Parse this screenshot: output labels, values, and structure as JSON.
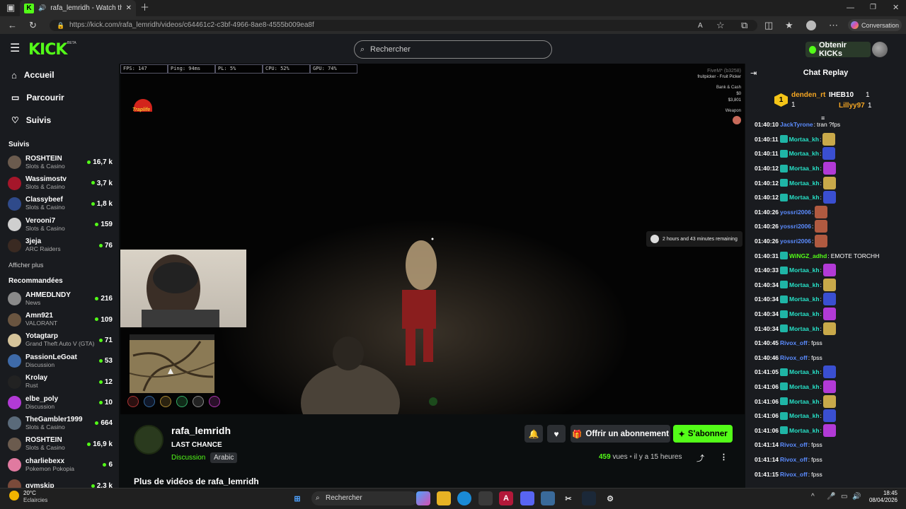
{
  "browser": {
    "tab_title": "rafa_lemridh - Watch the VO",
    "url": "https://kick.com/rafa_lemridh/videos/c64461c2-c3bf-4966-8ae8-4555b009ea8f",
    "conversation_label": "Conversation"
  },
  "header": {
    "logo": "KICK",
    "beta": "BETA",
    "search_placeholder": "Rechercher",
    "kicks_button": "Obtenir KICKs"
  },
  "sidebar": {
    "nav": [
      {
        "label": "Accueil",
        "icon": "home-icon"
      },
      {
        "label": "Parcourir",
        "icon": "browse-icon"
      },
      {
        "label": "Suivis",
        "icon": "heart-icon"
      }
    ],
    "followed_heading": "Suivis",
    "followed": [
      {
        "name": "ROSHTEIN",
        "category": "Slots & Casino",
        "viewers": "16,7 k",
        "color": "#6b5b4e"
      },
      {
        "name": "Wassimostv",
        "category": "Slots & Casino",
        "viewers": "3,7 k",
        "color": "#a5162a"
      },
      {
        "name": "Classybeef",
        "category": "Slots & Casino",
        "viewers": "1,8 k",
        "color": "#2f4a8a"
      },
      {
        "name": "Verooni7",
        "category": "Slots & Casino",
        "viewers": "159",
        "color": "#cfcfcf"
      },
      {
        "name": "3jeja",
        "category": "ARC Raiders",
        "viewers": "76",
        "color": "#3a2a22"
      }
    ],
    "show_more": "Afficher plus",
    "recommended_heading": "Recommandées",
    "recommended": [
      {
        "name": "AHMEDLNDY",
        "category": "News",
        "viewers": "216",
        "color": "#8a8a8a"
      },
      {
        "name": "Amn921",
        "category": "VALORANT",
        "viewers": "109",
        "color": "#6a5540"
      },
      {
        "name": "Yotagtarp",
        "category": "Grand Theft Auto V (GTA)",
        "viewers": "71",
        "color": "#d6c49a"
      },
      {
        "name": "PassionLeGoat",
        "category": "Discussion",
        "viewers": "53",
        "color": "#3e6aa8"
      },
      {
        "name": "Krolay",
        "category": "Rust",
        "viewers": "12",
        "color": "#222222"
      },
      {
        "name": "elbe_poly",
        "category": "Discussion",
        "viewers": "10",
        "color": "#b23ad6"
      },
      {
        "name": "TheGambler1999",
        "category": "Slots & Casino",
        "viewers": "664",
        "color": "#5a6a7a"
      },
      {
        "name": "ROSHTEIN",
        "category": "Slots & Casino",
        "viewers": "16,9 k",
        "color": "#6b5b4e"
      },
      {
        "name": "charliebexx",
        "category": "Pokemon Pokopia",
        "viewers": "6",
        "color": "#e07aa0"
      },
      {
        "name": "gymskip",
        "category": "",
        "viewers": "2,3 k",
        "color": "#7a4a3a"
      }
    ]
  },
  "video": {
    "hud": [
      "FPS: 147",
      "Ping: 94ms",
      "PL: 5%",
      "CPU: 52%",
      "GPU: 74%"
    ],
    "server_text": "FiveM* (b3258)",
    "job_text": "fruitpicker - Fruit Picker",
    "bank_label": "Bank & Cash",
    "bank_value": "$0",
    "cash_value": "$3,801",
    "weapon_label": "Weapon",
    "channel_logo": "Traplife",
    "remaining": "2 hours and 43 minutes remaining"
  },
  "stream": {
    "streamer": "rafa_lemridh",
    "title": "LAST CHANCE",
    "category": "Discussion",
    "tag": "Arabic",
    "gift_label": "Offrir un abonnement",
    "subscribe_label": "S'abonner",
    "views_count": "459",
    "views_label": "vues",
    "time_ago": "il y a 15 heures",
    "more_videos": "Plus de vidéos de rafa_lemridh"
  },
  "chat": {
    "title": "Chat Replay",
    "gifters": [
      {
        "rank": "1",
        "name": "denden_rt",
        "count": "1",
        "color": "#f5a623"
      },
      {
        "name": "IHEB10",
        "count": "1",
        "color": "#ffffff"
      },
      {
        "name": "Lillyy97",
        "count": "1",
        "color": "#f5a623"
      }
    ],
    "messages": [
      {
        "time": "01:40:10",
        "user": "JackTyrone",
        "color": "#5b8cff",
        "badge": false,
        "text": "tran ?fps",
        "emote": ""
      },
      {
        "time": "01:40:11",
        "user": "Mortaa_kh",
        "color": "#27e0c6",
        "badge": true,
        "text": "",
        "emote": "#c9a94a"
      },
      {
        "time": "01:40:11",
        "user": "Mortaa_kh",
        "color": "#27e0c6",
        "badge": true,
        "text": "",
        "emote": "#3a4fd1"
      },
      {
        "time": "01:40:12",
        "user": "Mortaa_kh",
        "color": "#27e0c6",
        "badge": true,
        "text": "",
        "emote": "#b23ad6"
      },
      {
        "time": "01:40:12",
        "user": "Mortaa_kh",
        "color": "#27e0c6",
        "badge": true,
        "text": "",
        "emote": "#c9a94a"
      },
      {
        "time": "01:40:12",
        "user": "Mortaa_kh",
        "color": "#27e0c6",
        "badge": true,
        "text": "",
        "emote": "#3a4fd1"
      },
      {
        "time": "01:40:26",
        "user": "yossri2006",
        "color": "#5b8cff",
        "badge": false,
        "text": "",
        "emote": "#b05a40"
      },
      {
        "time": "01:40:26",
        "user": "yossri2006",
        "color": "#5b8cff",
        "badge": false,
        "text": "",
        "emote": "#b05a40"
      },
      {
        "time": "01:40:26",
        "user": "yossri2006",
        "color": "#5b8cff",
        "badge": false,
        "text": "",
        "emote": "#b05a40"
      },
      {
        "time": "01:40:31",
        "user": "WiNGZ_adhd",
        "color": "#53fc18",
        "badge": true,
        "text": "EMOTE TORCHH",
        "emote": ""
      },
      {
        "time": "01:40:33",
        "user": "Mortaa_kh",
        "color": "#27e0c6",
        "badge": true,
        "text": "",
        "emote": "#b23ad6"
      },
      {
        "time": "01:40:34",
        "user": "Mortaa_kh",
        "color": "#27e0c6",
        "badge": true,
        "text": "",
        "emote": "#c9a94a"
      },
      {
        "time": "01:40:34",
        "user": "Mortaa_kh",
        "color": "#27e0c6",
        "badge": true,
        "text": "",
        "emote": "#3a4fd1"
      },
      {
        "time": "01:40:34",
        "user": "Mortaa_kh",
        "color": "#27e0c6",
        "badge": true,
        "text": "",
        "emote": "#b23ad6"
      },
      {
        "time": "01:40:34",
        "user": "Mortaa_kh",
        "color": "#27e0c6",
        "badge": true,
        "text": "",
        "emote": "#c9a94a"
      },
      {
        "time": "01:40:45",
        "user": "Rivox_off",
        "color": "#5b8cff",
        "badge": false,
        "text": "fpss",
        "emote": ""
      },
      {
        "time": "01:40:46",
        "user": "Rivox_off",
        "color": "#5b8cff",
        "badge": false,
        "text": "fpss",
        "emote": ""
      },
      {
        "time": "01:41:05",
        "user": "Mortaa_kh",
        "color": "#27e0c6",
        "badge": true,
        "text": "",
        "emote": "#3a4fd1"
      },
      {
        "time": "01:41:06",
        "user": "Mortaa_kh",
        "color": "#27e0c6",
        "badge": true,
        "text": "",
        "emote": "#b23ad6"
      },
      {
        "time": "01:41:06",
        "user": "Mortaa_kh",
        "color": "#27e0c6",
        "badge": true,
        "text": "",
        "emote": "#c9a94a"
      },
      {
        "time": "01:41:06",
        "user": "Mortaa_kh",
        "color": "#27e0c6",
        "badge": true,
        "text": "",
        "emote": "#3a4fd1"
      },
      {
        "time": "01:41:06",
        "user": "Mortaa_kh",
        "color": "#27e0c6",
        "badge": true,
        "text": "",
        "emote": "#b23ad6"
      },
      {
        "time": "01:41:14",
        "user": "Rivox_off",
        "color": "#5b8cff",
        "badge": false,
        "text": "fpss",
        "emote": ""
      },
      {
        "time": "01:41:14",
        "user": "Rivox_off",
        "color": "#5b8cff",
        "badge": false,
        "text": "fpss",
        "emote": ""
      },
      {
        "time": "01:41:15",
        "user": "Rivox_off",
        "color": "#5b8cff",
        "badge": false,
        "text": "fpss",
        "emote": ""
      }
    ]
  },
  "taskbar": {
    "weather_temp": "20°C",
    "weather_desc": "Eclaircies",
    "search_placeholder": "Rechercher",
    "time": "18:45",
    "date": "08/04/2026"
  },
  "colors": {
    "kick_green": "#53fc18",
    "panel": "#191b1f",
    "button": "#2c2f33"
  }
}
